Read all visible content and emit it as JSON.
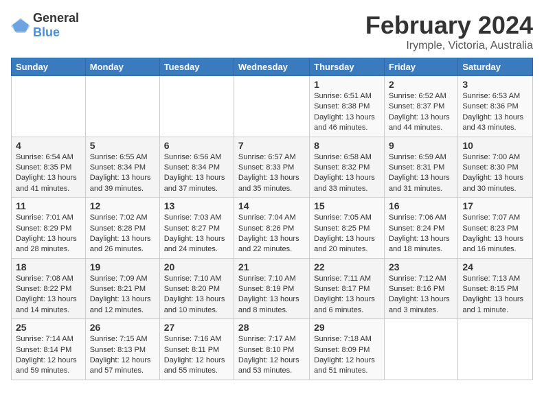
{
  "header": {
    "logo_general": "General",
    "logo_blue": "Blue",
    "month": "February 2024",
    "location": "Irymple, Victoria, Australia"
  },
  "weekdays": [
    "Sunday",
    "Monday",
    "Tuesday",
    "Wednesday",
    "Thursday",
    "Friday",
    "Saturday"
  ],
  "weeks": [
    {
      "days": [
        {
          "num": "",
          "info": ""
        },
        {
          "num": "",
          "info": ""
        },
        {
          "num": "",
          "info": ""
        },
        {
          "num": "",
          "info": ""
        },
        {
          "num": "1",
          "info": "Sunrise: 6:51 AM\nSunset: 8:38 PM\nDaylight: 13 hours and 46 minutes."
        },
        {
          "num": "2",
          "info": "Sunrise: 6:52 AM\nSunset: 8:37 PM\nDaylight: 13 hours and 44 minutes."
        },
        {
          "num": "3",
          "info": "Sunrise: 6:53 AM\nSunset: 8:36 PM\nDaylight: 13 hours and 43 minutes."
        }
      ]
    },
    {
      "days": [
        {
          "num": "4",
          "info": "Sunrise: 6:54 AM\nSunset: 8:35 PM\nDaylight: 13 hours and 41 minutes."
        },
        {
          "num": "5",
          "info": "Sunrise: 6:55 AM\nSunset: 8:34 PM\nDaylight: 13 hours and 39 minutes."
        },
        {
          "num": "6",
          "info": "Sunrise: 6:56 AM\nSunset: 8:34 PM\nDaylight: 13 hours and 37 minutes."
        },
        {
          "num": "7",
          "info": "Sunrise: 6:57 AM\nSunset: 8:33 PM\nDaylight: 13 hours and 35 minutes."
        },
        {
          "num": "8",
          "info": "Sunrise: 6:58 AM\nSunset: 8:32 PM\nDaylight: 13 hours and 33 minutes."
        },
        {
          "num": "9",
          "info": "Sunrise: 6:59 AM\nSunset: 8:31 PM\nDaylight: 13 hours and 31 minutes."
        },
        {
          "num": "10",
          "info": "Sunrise: 7:00 AM\nSunset: 8:30 PM\nDaylight: 13 hours and 30 minutes."
        }
      ]
    },
    {
      "days": [
        {
          "num": "11",
          "info": "Sunrise: 7:01 AM\nSunset: 8:29 PM\nDaylight: 13 hours and 28 minutes."
        },
        {
          "num": "12",
          "info": "Sunrise: 7:02 AM\nSunset: 8:28 PM\nDaylight: 13 hours and 26 minutes."
        },
        {
          "num": "13",
          "info": "Sunrise: 7:03 AM\nSunset: 8:27 PM\nDaylight: 13 hours and 24 minutes."
        },
        {
          "num": "14",
          "info": "Sunrise: 7:04 AM\nSunset: 8:26 PM\nDaylight: 13 hours and 22 minutes."
        },
        {
          "num": "15",
          "info": "Sunrise: 7:05 AM\nSunset: 8:25 PM\nDaylight: 13 hours and 20 minutes."
        },
        {
          "num": "16",
          "info": "Sunrise: 7:06 AM\nSunset: 8:24 PM\nDaylight: 13 hours and 18 minutes."
        },
        {
          "num": "17",
          "info": "Sunrise: 7:07 AM\nSunset: 8:23 PM\nDaylight: 13 hours and 16 minutes."
        }
      ]
    },
    {
      "days": [
        {
          "num": "18",
          "info": "Sunrise: 7:08 AM\nSunset: 8:22 PM\nDaylight: 13 hours and 14 minutes."
        },
        {
          "num": "19",
          "info": "Sunrise: 7:09 AM\nSunset: 8:21 PM\nDaylight: 13 hours and 12 minutes."
        },
        {
          "num": "20",
          "info": "Sunrise: 7:10 AM\nSunset: 8:20 PM\nDaylight: 13 hours and 10 minutes."
        },
        {
          "num": "21",
          "info": "Sunrise: 7:10 AM\nSunset: 8:19 PM\nDaylight: 13 hours and 8 minutes."
        },
        {
          "num": "22",
          "info": "Sunrise: 7:11 AM\nSunset: 8:17 PM\nDaylight: 13 hours and 6 minutes."
        },
        {
          "num": "23",
          "info": "Sunrise: 7:12 AM\nSunset: 8:16 PM\nDaylight: 13 hours and 3 minutes."
        },
        {
          "num": "24",
          "info": "Sunrise: 7:13 AM\nSunset: 8:15 PM\nDaylight: 13 hours and 1 minute."
        }
      ]
    },
    {
      "days": [
        {
          "num": "25",
          "info": "Sunrise: 7:14 AM\nSunset: 8:14 PM\nDaylight: 12 hours and 59 minutes."
        },
        {
          "num": "26",
          "info": "Sunrise: 7:15 AM\nSunset: 8:13 PM\nDaylight: 12 hours and 57 minutes."
        },
        {
          "num": "27",
          "info": "Sunrise: 7:16 AM\nSunset: 8:11 PM\nDaylight: 12 hours and 55 minutes."
        },
        {
          "num": "28",
          "info": "Sunrise: 7:17 AM\nSunset: 8:10 PM\nDaylight: 12 hours and 53 minutes."
        },
        {
          "num": "29",
          "info": "Sunrise: 7:18 AM\nSunset: 8:09 PM\nDaylight: 12 hours and 51 minutes."
        },
        {
          "num": "",
          "info": ""
        },
        {
          "num": "",
          "info": ""
        }
      ]
    }
  ]
}
